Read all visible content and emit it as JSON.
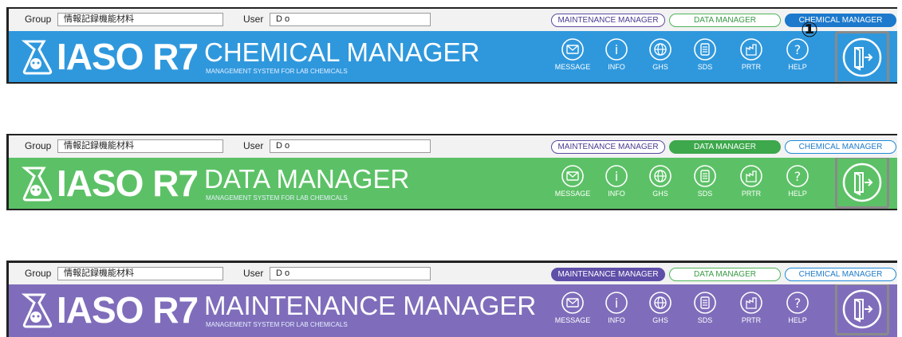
{
  "common": {
    "group_label": "Group",
    "group_value": "情報記録機能材料",
    "user_label": "User",
    "user_value": "D o",
    "managers": {
      "maintenance": "MAINTENANCE MANAGER",
      "data": "DATA MANAGER",
      "chemical": "CHEMICAL MANAGER"
    },
    "logo": "IASO R7",
    "subtitle": "MANAGEMENT SYSTEM FOR LAB CHEMICALS",
    "tools": {
      "message": "MESSAGE",
      "info": "INFO",
      "ghs": "GHS",
      "sds": "SDS",
      "prtr": "PRTR",
      "help": "HELP"
    },
    "exit_icon": "exit-door-icon"
  },
  "headers": [
    {
      "title": "CHEMICAL MANAGER",
      "active": "chemical",
      "color": "#2f98dd"
    },
    {
      "title": "DATA MANAGER",
      "active": "data",
      "color": "#5cc166"
    },
    {
      "title": "MAINTENANCE MANAGER",
      "active": "maintenance",
      "color": "#7f6dbb"
    }
  ],
  "annotation_marker": "①"
}
